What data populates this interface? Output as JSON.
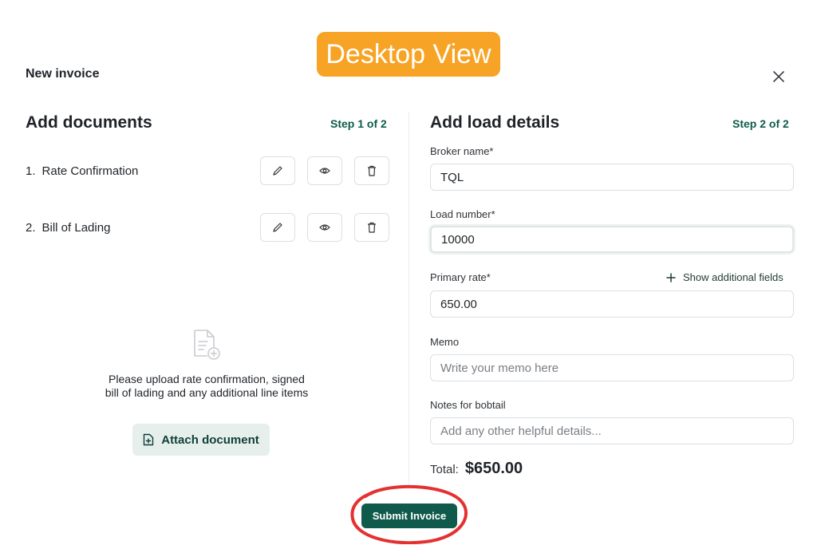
{
  "badge": {
    "label": "Desktop View"
  },
  "modal": {
    "title": "New invoice"
  },
  "documents": {
    "title": "Add documents",
    "step": "Step 1 of 2",
    "items": [
      {
        "index": "1.",
        "label": "Rate Confirmation"
      },
      {
        "index": "2.",
        "label": "Bill of Lading"
      }
    ],
    "empty_text": "Please upload rate confirmation, signed bill of lading and any additional line items",
    "attach_label": "Attach document"
  },
  "load": {
    "title": "Add load details",
    "step": "Step 2 of 2",
    "broker": {
      "label": "Broker name*",
      "value": "TQL"
    },
    "load_number": {
      "label": "Load number*",
      "value": "10000"
    },
    "primary_rate": {
      "label": "Primary rate*",
      "value": "650.00"
    },
    "show_more_label": "Show additional fields",
    "memo": {
      "label": "Memo",
      "placeholder": "Write your memo here"
    },
    "notes": {
      "label": "Notes for bobtail",
      "placeholder": "Add any other helpful details..."
    },
    "total_label": "Total:",
    "total_value": "$650.00"
  },
  "submit_label": "Submit Invoice",
  "colors": {
    "accent": "#0f5a4b",
    "badge": "#f7a325",
    "annotation": "#e53030"
  },
  "icons": [
    "close-icon",
    "pencil-icon",
    "eye-icon",
    "trash-icon",
    "document-plus-icon",
    "file-add-icon",
    "plus-icon"
  ]
}
